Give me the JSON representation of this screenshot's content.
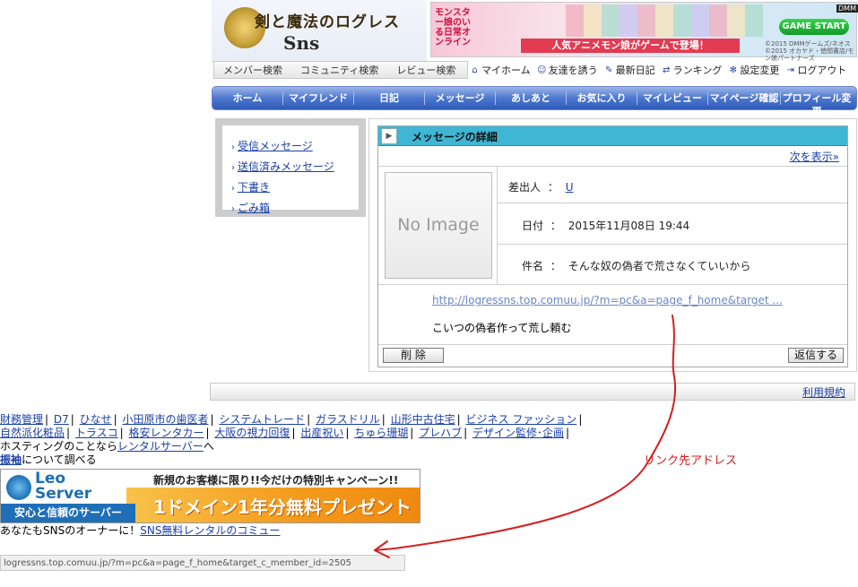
{
  "header": {
    "logo_title": "剣と魔法のログレス",
    "logo_sub": "Sns",
    "banner": {
      "title": "モンスター娘のいる日常オンライン",
      "strip": "人気アニメモン娘がゲームで登場！",
      "button": "GAME START",
      "copyright": "©2015 DMMゲームズ/ネオス ©2015 オカヤド・徳間書店/モン娘パートナーズ",
      "dmm": "DMM"
    },
    "subnav": [
      "メンバー検索",
      "コミュニティ検索",
      "レビュー検索"
    ],
    "toolnav": [
      {
        "icon": "home-icon",
        "glyph": "⌂",
        "label": "マイホーム"
      },
      {
        "icon": "person-icon",
        "glyph": "☺",
        "label": "友達を誘う"
      },
      {
        "icon": "pencil-icon",
        "glyph": "✎",
        "label": "最新日記"
      },
      {
        "icon": "refresh-icon",
        "glyph": "⇄",
        "label": "ランキング"
      },
      {
        "icon": "gear-icon",
        "glyph": "✻",
        "label": "設定変更"
      },
      {
        "icon": "logout-icon",
        "glyph": "⇥",
        "label": "ログアウト"
      }
    ]
  },
  "mainnav": [
    "ホーム",
    "マイフレンド",
    "日記",
    "メッセージ",
    "あしあと",
    "お気に入り",
    "マイレビュー",
    "マイページ確認",
    "プロフィール変更"
  ],
  "sidemenu": [
    "受信メッセージ",
    "送信済みメッセージ",
    "下書き",
    "ごみ箱"
  ],
  "message": {
    "header_title": "メッセージの詳細",
    "next_link": "次を表示»",
    "no_image": "No Image",
    "sender_label": "差出人",
    "sender_value": "U",
    "date_label": "日付",
    "date_value": "2015年11月08日 19:44",
    "subject_label": "件名",
    "subject_value": "そんな奴の偽者で荒さなくていいから",
    "separator": "：",
    "link_text": "http://logressns.top.comuu.jp/?m=pc&a=page_f_home&target ...",
    "body": "こいつの偽者作って荒し頼む",
    "delete_button": "削 除",
    "reply_button": "返信する"
  },
  "footer": {
    "terms": "利用規約"
  },
  "ads": {
    "row1": [
      "財務管理",
      "D7",
      "ひなせ",
      "小田原市の歯医者",
      "システムトレード",
      "ガラスドリル",
      "山形中古住宅",
      "ビジネス ファッション"
    ],
    "row2": [
      "自然派化粧品",
      "トラスコ",
      "格安レンタカー",
      "大阪の視力回復",
      "出産祝い",
      "ちゅら珊瑚",
      "プレハブ",
      "デザイン監修･企画"
    ],
    "hosting_prefix": "ホスティングのことなら",
    "hosting_link": "レンタルサーバー",
    "hosting_suffix": "へ",
    "search_link": "振袖",
    "search_suffix": "について調べる"
  },
  "leo": {
    "name1": "Leo",
    "name2": "Server",
    "top_text": "新規のお客様に限り!!今だけの特別キャンペーン!!",
    "tagline": "安心と信頼のサーバー",
    "promo": "1ドメイン1年分無料プレゼント"
  },
  "owner": {
    "prefix": "あなたもSNSのオーナーに！",
    "link": "SNS無料レンタルのコミュー"
  },
  "status_bar": "logressns.top.comuu.jp/?m=pc&a=page_f_home&target_c_member_id=2505",
  "annotation": "リンク先アドレス",
  "colors": {
    "nav_blue": "#2f5bb9",
    "header_cyan": "#3fb6d4",
    "link": "#1a3fa8",
    "annotation_red": "#d41e1e"
  }
}
